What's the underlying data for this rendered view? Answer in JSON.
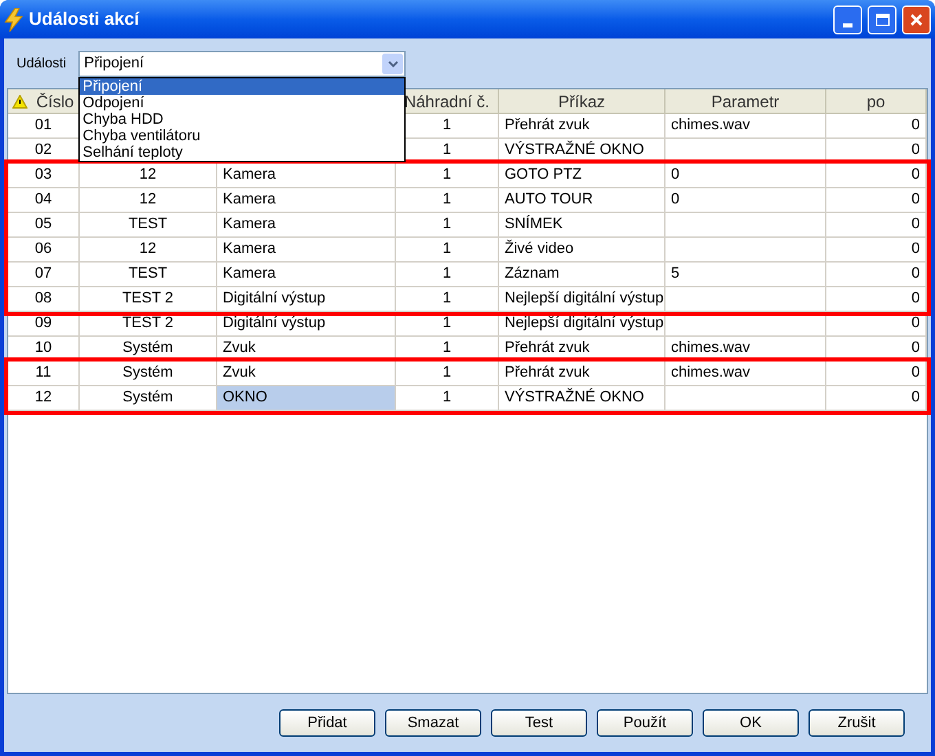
{
  "window": {
    "title": "Události akcí"
  },
  "events": {
    "label": "Události",
    "value": "Připojení",
    "expanded": true,
    "options": [
      {
        "label": "Připojení",
        "selected": true
      },
      {
        "label": "Odpojení",
        "selected": false
      },
      {
        "label": "Chyba HDD",
        "selected": false
      },
      {
        "label": "Chyba ventilátoru",
        "selected": false
      },
      {
        "label": "Selhání teploty",
        "selected": false
      }
    ]
  },
  "table": {
    "columns": [
      "Číslo",
      null,
      null,
      "Náhradní č.",
      "Příkaz",
      "Parametr",
      "po"
    ],
    "rows": [
      {
        "cells": [
          "01",
          null,
          null,
          "1",
          "Přehrát zvuk",
          "chimes.wav",
          "0"
        ],
        "framed": false
      },
      {
        "cells": [
          "02",
          null,
          null,
          "1",
          "VÝSTRAŽNÉ OKNO",
          null,
          "0"
        ],
        "framed": false
      },
      {
        "cells": [
          "03",
          "12",
          "Kamera",
          "1",
          "GOTO PTZ",
          "0",
          "0"
        ],
        "framed": true,
        "selected": false
      },
      {
        "cells": [
          "04",
          "12",
          "Kamera",
          "1",
          "AUTO TOUR",
          "0",
          "0"
        ],
        "framed": true,
        "selected": false
      },
      {
        "cells": [
          "05",
          "TEST",
          "Kamera",
          "1",
          "SNÍMEK",
          null,
          "0"
        ],
        "framed": true,
        "selected": false
      },
      {
        "cells": [
          "06",
          "12",
          "Kamera",
          "1",
          "Živé video",
          null,
          "0"
        ],
        "framed": true,
        "selected": false
      },
      {
        "cells": [
          "07",
          "TEST",
          "Kamera",
          "1",
          "Záznam",
          "5",
          "0"
        ],
        "framed": true,
        "selected": false
      },
      {
        "cells": [
          "08",
          "TEST 2",
          "Digitální výstup",
          "1",
          "Nejlepší digitální výstup",
          null,
          "0"
        ],
        "framed": true,
        "selected": false
      },
      {
        "cells": [
          "09",
          "TEST 2",
          "Digitální výstup",
          "1",
          "Nejlepší digitální výstup",
          null,
          "0"
        ],
        "framed": false,
        "selected": false
      },
      {
        "cells": [
          "10",
          "Systém",
          "Zvuk",
          "1",
          "Přehrát zvuk",
          "chimes.wav",
          "0"
        ],
        "framed": false,
        "selected": false
      },
      {
        "cells": [
          "11",
          "Systém",
          "Zvuk",
          "1",
          "Přehrát zvuk",
          "chimes.wav",
          "0"
        ],
        "framed": true,
        "selected": false
      },
      {
        "cells": [
          "12",
          "Systém",
          "OKNO",
          "1",
          "VÝSTRAŽNÉ OKNO",
          null,
          "0"
        ],
        "framed": true,
        "selected": true
      }
    ]
  },
  "buttons": [
    "Přidat",
    "Smazat",
    "Test",
    "Použít",
    "OK",
    "Zrušit"
  ]
}
